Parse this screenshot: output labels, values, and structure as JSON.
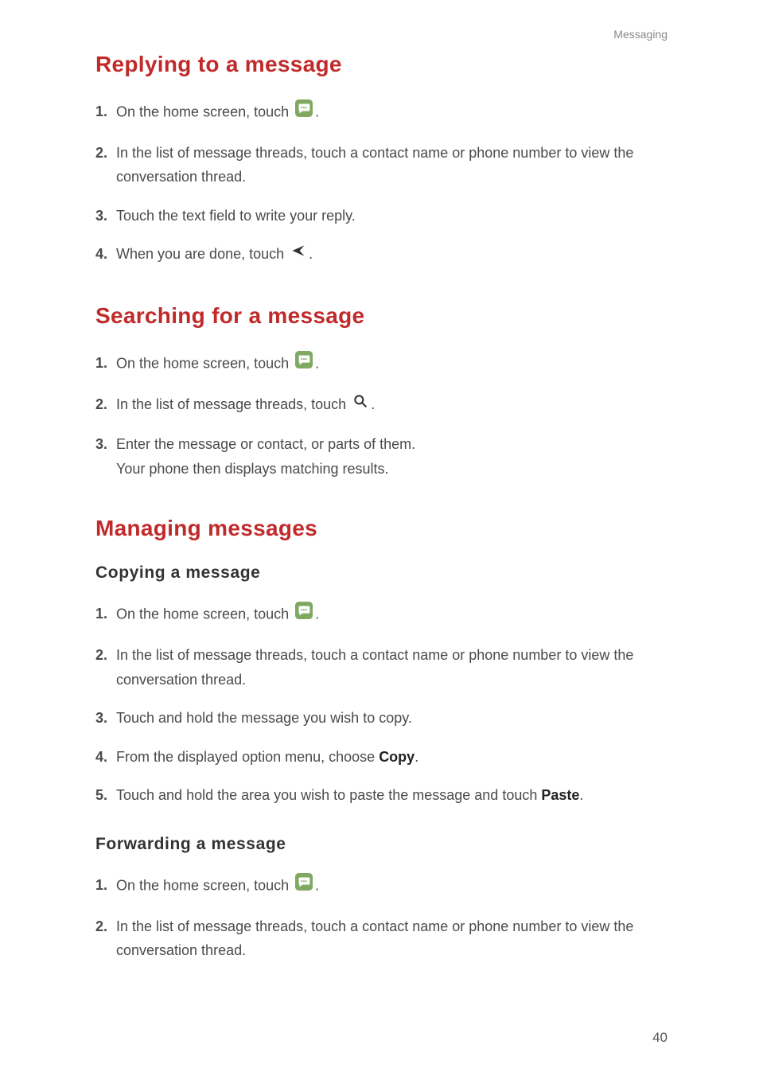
{
  "header": {
    "category": "Messaging",
    "page_number": "40"
  },
  "sections": {
    "replying": {
      "title": "Replying to a message",
      "steps": {
        "s1": {
          "num": "1.",
          "a": "On the home screen, touch",
          "b": "."
        },
        "s2": {
          "num": "2.",
          "text": "In the list of message threads, touch a contact name or phone number to view the conversation thread."
        },
        "s3": {
          "num": "3.",
          "text": "Touch the text field to write your reply."
        },
        "s4": {
          "num": "4.",
          "a": "When you are done, touch",
          "b": "."
        }
      }
    },
    "searching": {
      "title": "Searching for a message",
      "steps": {
        "s1": {
          "num": "1.",
          "a": "On the home screen, touch",
          "b": "."
        },
        "s2": {
          "num": "2.",
          "a": "In the list of message threads, touch",
          "b": "."
        },
        "s3": {
          "num": "3.",
          "text": "Enter the message or contact, or parts of them.",
          "sub": "Your phone then displays matching results."
        }
      }
    },
    "managing": {
      "title": "Managing messages",
      "copying": {
        "title": "Copying  a  message",
        "steps": {
          "s1": {
            "num": "1.",
            "a": "On the home screen, touch",
            "b": "."
          },
          "s2": {
            "num": "2.",
            "text": "In the list of message threads, touch a contact name or phone number to view the conversation thread."
          },
          "s3": {
            "num": "3.",
            "text": "Touch and hold the message you wish to copy."
          },
          "s4": {
            "num": "4.",
            "a": "From the displayed option menu, choose ",
            "bold": "Copy",
            "b": "."
          },
          "s5": {
            "num": "5.",
            "a": "Touch and hold the area you wish to paste the message and touch ",
            "bold": "Paste",
            "b": "."
          }
        }
      },
      "forwarding": {
        "title": "Forwarding  a  message",
        "steps": {
          "s1": {
            "num": "1.",
            "a": "On the home screen, touch",
            "b": "."
          },
          "s2": {
            "num": "2.",
            "text": "In the list of message threads, touch a contact name or phone number to view the conversation thread."
          }
        }
      }
    }
  }
}
